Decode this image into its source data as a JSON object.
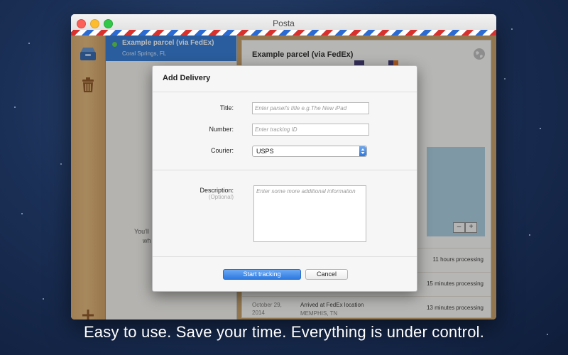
{
  "window": {
    "title": "Posta"
  },
  "parcel_list": {
    "selected": {
      "name": "Example parcel (via FedEx)",
      "location": "Coral Springs, FL"
    },
    "hint_lines": [
      "You'll",
      "wh"
    ]
  },
  "detail": {
    "title": "Example parcel (via FedEx)",
    "zoom_out": "–",
    "zoom_in": "+",
    "history": [
      {
        "date": "",
        "event": "",
        "place": "",
        "time": "11 hours processing"
      },
      {
        "date": "",
        "event": "",
        "place": "",
        "time": "15 minutes processing"
      },
      {
        "date": "October 29, 2014",
        "event": "Arrived at FedEx location",
        "place": "MEMPHIS, TN",
        "time": "13 minutes processing"
      }
    ]
  },
  "dialog": {
    "title": "Add Delivery",
    "title_label": "Title:",
    "title_placeholder": "Enter parsel's title e.g.The New iPad",
    "number_label": "Number:",
    "number_placeholder": "Enter tracking ID",
    "courier_label": "Courier:",
    "courier_value": "USPS",
    "description_label": "Description:",
    "description_sub": "(Optional)",
    "description_placeholder": "Enter some more additional information",
    "start_button": "Start tracking",
    "cancel_button": "Cancel"
  },
  "tagline": "Easy to use. Save your time. Everything is under control.",
  "colors": {
    "accent": "#2c77d4",
    "wood": "#d9a869",
    "status_dot": "#57d24a"
  },
  "icons": [
    "inbox-icon",
    "trash-icon",
    "add-icon",
    "globe-icon",
    "select-arrows-icon"
  ]
}
